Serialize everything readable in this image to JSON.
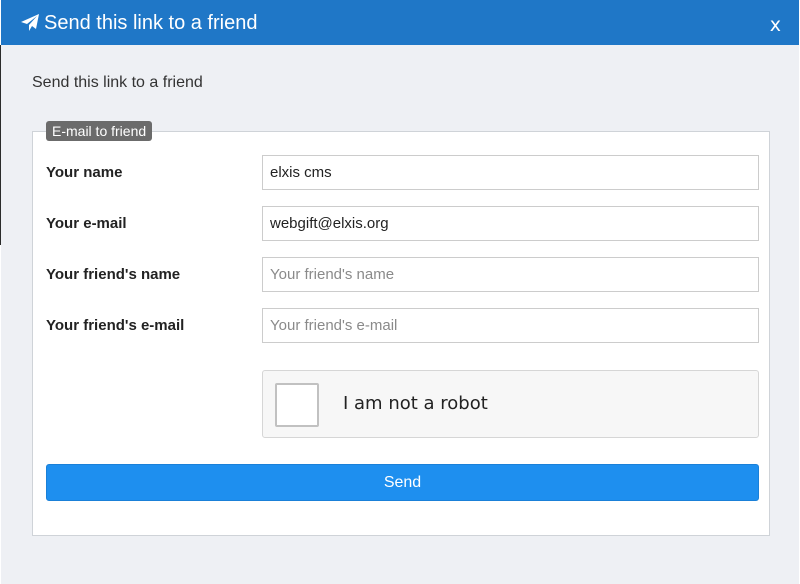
{
  "dialog": {
    "title": "Send this link to a friend",
    "close_label": "x",
    "subtitle": "Send this link to a friend"
  },
  "form": {
    "legend": "E-mail to friend",
    "fields": [
      {
        "label": "Your name",
        "value": "elxis cms",
        "placeholder": ""
      },
      {
        "label": "Your e-mail",
        "value": "webgift@elxis.org",
        "placeholder": ""
      },
      {
        "label": "Your friend's name",
        "value": "",
        "placeholder": "Your friend's name"
      },
      {
        "label": "Your friend's e-mail",
        "value": "",
        "placeholder": "Your friend's e-mail"
      }
    ],
    "captcha_label": "I am not a robot",
    "captcha_checked": false,
    "submit_label": "Send"
  },
  "colors": {
    "titlebar": "#1f77c7",
    "submit": "#1e8fef",
    "legend": "#6b6b6b"
  },
  "icons": {
    "title": "paper-plane-icon"
  }
}
